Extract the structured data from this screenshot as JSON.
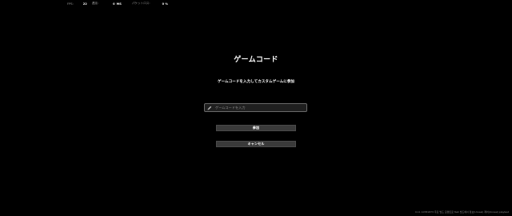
{
  "hud": {
    "fps_label": "FPS:",
    "fps_value": "22",
    "ping_label": "遅延:",
    "ping_value": "0",
    "ping_unit": "MS",
    "packet_loss_label": "パケットロス:",
    "packet_loss_value": "0 %"
  },
  "dialog": {
    "title": "ゲームコード",
    "instruction": "ゲームコードを入力してカスタムゲームに参加",
    "code_input": {
      "value": "",
      "placeholder": "ゲームコードを入力",
      "icon": "pencil-icon"
    },
    "join_label": "参加",
    "cancel_label": "キャンセル"
  },
  "footer": {
    "build_info": "0.11 10781873 주요 빌드 모멘트로 Test 빌드에서 정보(Unreal) 제어(Unreal) playtest"
  },
  "colors": {
    "background": "#000000",
    "text": "#ffffff",
    "button_bg": "#3a3a3a",
    "input_bg": "#1f1f1f",
    "input_border": "#6a6a6a"
  }
}
